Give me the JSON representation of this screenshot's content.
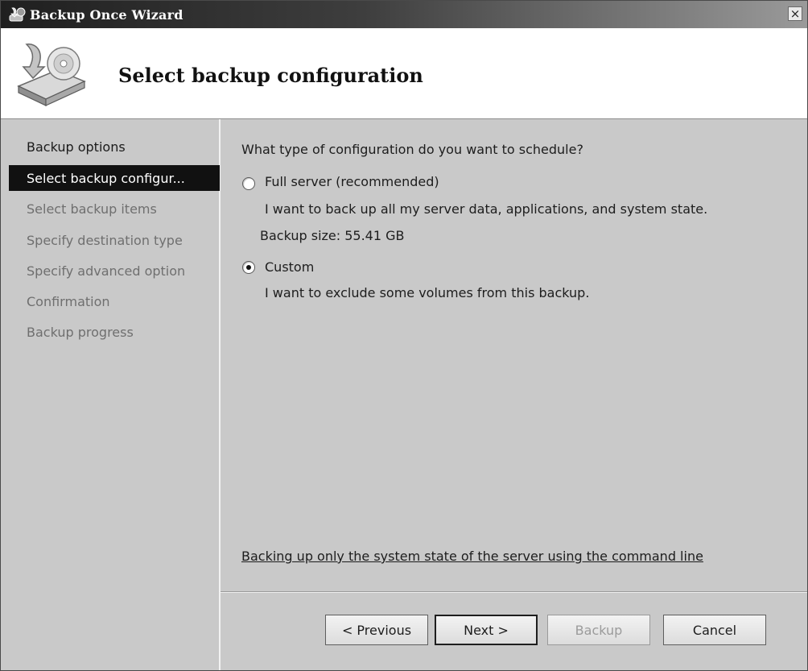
{
  "window": {
    "title": "Backup Once Wizard",
    "close_glyph": "×"
  },
  "header": {
    "title": "Select backup configuration",
    "icon": "backup-disk-icon"
  },
  "nav": {
    "items": [
      {
        "label": "Backup options",
        "state": "completed"
      },
      {
        "label": "Select backup configur...",
        "state": "current"
      },
      {
        "label": "Select backup items",
        "state": "pending"
      },
      {
        "label": "Specify destination type",
        "state": "pending"
      },
      {
        "label": "Specify advanced option",
        "state": "pending"
      },
      {
        "label": "Confirmation",
        "state": "pending"
      },
      {
        "label": "Backup progress",
        "state": "pending"
      }
    ]
  },
  "main": {
    "question": "What type of configuration do you want to schedule?",
    "options": [
      {
        "label": "Full server (recommended)",
        "description": "I want to back up all my server data, applications, and system state.",
        "extra": "Backup size: 55.41 GB",
        "selected": false
      },
      {
        "label": "Custom",
        "description": "I want to exclude some volumes from this backup.",
        "selected": true
      }
    ],
    "link": "Backing up only the system state of the server using the command line"
  },
  "buttons": {
    "previous": "< Previous",
    "next": "Next >",
    "backup": "Backup",
    "cancel": "Cancel"
  },
  "colors": {
    "background": "#c9c9c9",
    "selected_nav": "#111111",
    "header_bg": "#ffffff"
  }
}
